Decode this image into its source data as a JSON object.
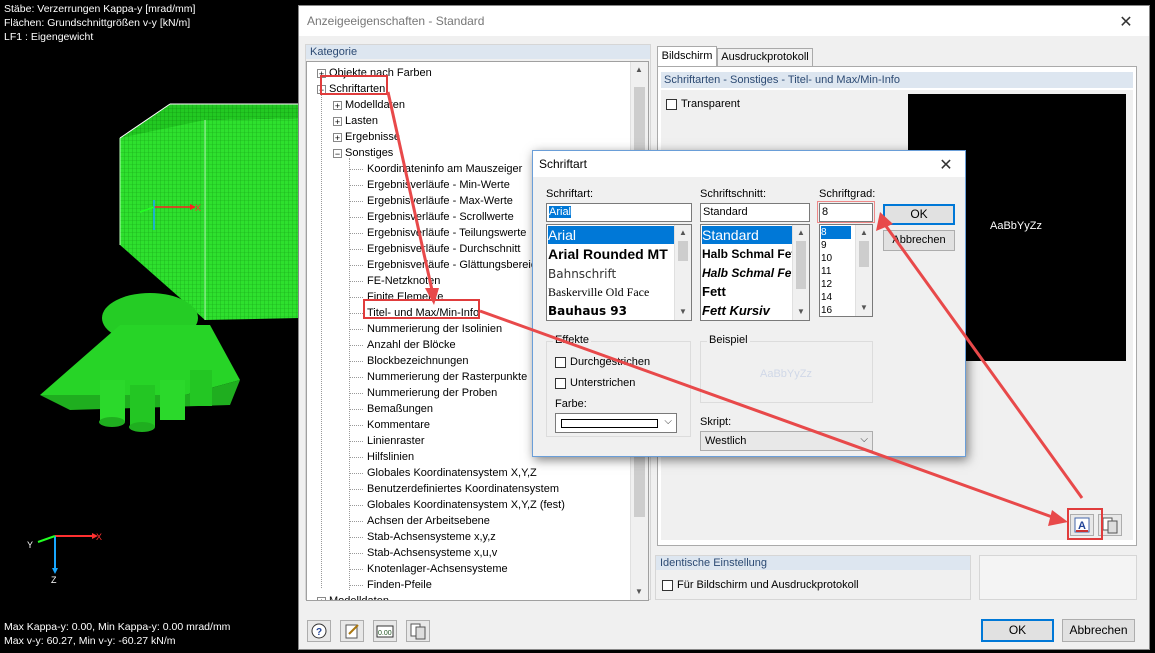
{
  "viewport": {
    "info_lines": [
      "Stäbe: Verzerrungen Kappa-y [mrad/mm]",
      "Flächen: Grundschnittgrößen v-y [kN/m]",
      "LF1 : Eigengewicht"
    ],
    "axis_labels": {
      "x": "X",
      "y": "Y",
      "z": "Z"
    },
    "bottom_lines": [
      "Max Kappa-y: 0.00, Min Kappa-y: 0.00 mrad/mm",
      "Max v-y: 60.27, Min v-y: -60.27 kN/m"
    ]
  },
  "dialog": {
    "title": "Anzeigeeigenschaften - Standard",
    "close_glyph": "✕",
    "category_label": "Kategorie",
    "tree": [
      {
        "label": "Objekte nach Farben",
        "level": 0,
        "expander": "+"
      },
      {
        "label": "Schriftarten",
        "level": 0,
        "expander": "−"
      },
      {
        "label": "Modelldaten",
        "level": 1,
        "expander": "+"
      },
      {
        "label": "Lasten",
        "level": 1,
        "expander": "+"
      },
      {
        "label": "Ergebnisse",
        "level": 1,
        "expander": "+"
      },
      {
        "label": "Sonstiges",
        "level": 1,
        "expander": "−"
      },
      {
        "label": "Koordinateninfo am Mauszeiger",
        "level": 2
      },
      {
        "label": "Ergebnisverläufe - Min-Werte",
        "level": 2
      },
      {
        "label": "Ergebnisverläufe - Max-Werte",
        "level": 2
      },
      {
        "label": "Ergebnisverläufe - Scrollwerte",
        "level": 2
      },
      {
        "label": "Ergebnisverläufe - Teilungswerte",
        "level": 2
      },
      {
        "label": "Ergebnisverläufe - Durchschnitt",
        "level": 2
      },
      {
        "label": "Ergebnisverläufe - Glättungsbereich",
        "level": 2
      },
      {
        "label": "FE-Netzknoten",
        "level": 2
      },
      {
        "label": "Finite Elemente",
        "level": 2
      },
      {
        "label": "Titel- und Max/Min-Info",
        "level": 2
      },
      {
        "label": "Nummerierung der Isolinien",
        "level": 2
      },
      {
        "label": "Anzahl der Blöcke",
        "level": 2
      },
      {
        "label": "Blockbezeichnungen",
        "level": 2
      },
      {
        "label": "Nummerierung der Rasterpunkte",
        "level": 2
      },
      {
        "label": "Nummerierung der Proben",
        "level": 2
      },
      {
        "label": "Bemaßungen",
        "level": 2
      },
      {
        "label": "Kommentare",
        "level": 2
      },
      {
        "label": "Linienraster",
        "level": 2
      },
      {
        "label": "Hilfslinien",
        "level": 2
      },
      {
        "label": "Globales Koordinatensystem X,Y,Z",
        "level": 2
      },
      {
        "label": "Benutzerdefiniertes Koordinatensystem",
        "level": 2
      },
      {
        "label": "Globales Koordinatensystem X,Y,Z (fest)",
        "level": 2
      },
      {
        "label": "Achsen der Arbeitsebene",
        "level": 2
      },
      {
        "label": "Stab-Achsensysteme x,y,z",
        "level": 2
      },
      {
        "label": "Stab-Achsensysteme x,u,v",
        "level": 2
      },
      {
        "label": "Knotenlager-Achsensysteme",
        "level": 2
      },
      {
        "label": "Finden-Pfeile",
        "level": 2
      },
      {
        "label": "Modelldaten",
        "level": 0,
        "expander": "+"
      }
    ],
    "tabs": [
      "Bildschirm",
      "Ausdruckprotokoll"
    ],
    "section_title": "Schriftarten - Sonstiges - Titel- und Max/Min-Info",
    "transparent_label": "Transparent",
    "preview_text": "AaBbYyZz",
    "identical_title": "Identische Einstellung",
    "identical_checkbox": "Für Bildschirm und Ausdruckprotokoll",
    "ok": "OK",
    "cancel": "Abbrechen",
    "colors": {
      "accent": "#0078d7",
      "highlight": "#e03c3c",
      "mesh": "#29d629"
    }
  },
  "font_dialog": {
    "title": "Schriftart",
    "close_glyph": "✕",
    "font_label": "Schriftart:",
    "font_value": "Arial",
    "fonts": [
      "Arial",
      "Arial Rounded MT",
      "Bahnschrift",
      "Baskerville Old Face",
      "Bauhaus 93"
    ],
    "style_label": "Schriftschnitt:",
    "style_value": "Standard",
    "styles": [
      "Standard",
      "Halb Schmal Fett",
      "Halb Schmal Fett",
      "Fett",
      "Fett Kursiv"
    ],
    "size_label": "Schriftgrad:",
    "size_value": "8",
    "sizes": [
      "8",
      "9",
      "10",
      "11",
      "12",
      "14",
      "16"
    ],
    "ok": "OK",
    "cancel": "Abbrechen",
    "effects_label": "Effekte",
    "strike_label": "Durchgestrichen",
    "underline_label": "Unterstrichen",
    "color_label": "Farbe:",
    "sample_label": "Beispiel",
    "sample_text": "AaBbYyZz",
    "script_label": "Skript:",
    "script_value": "Westlich"
  }
}
